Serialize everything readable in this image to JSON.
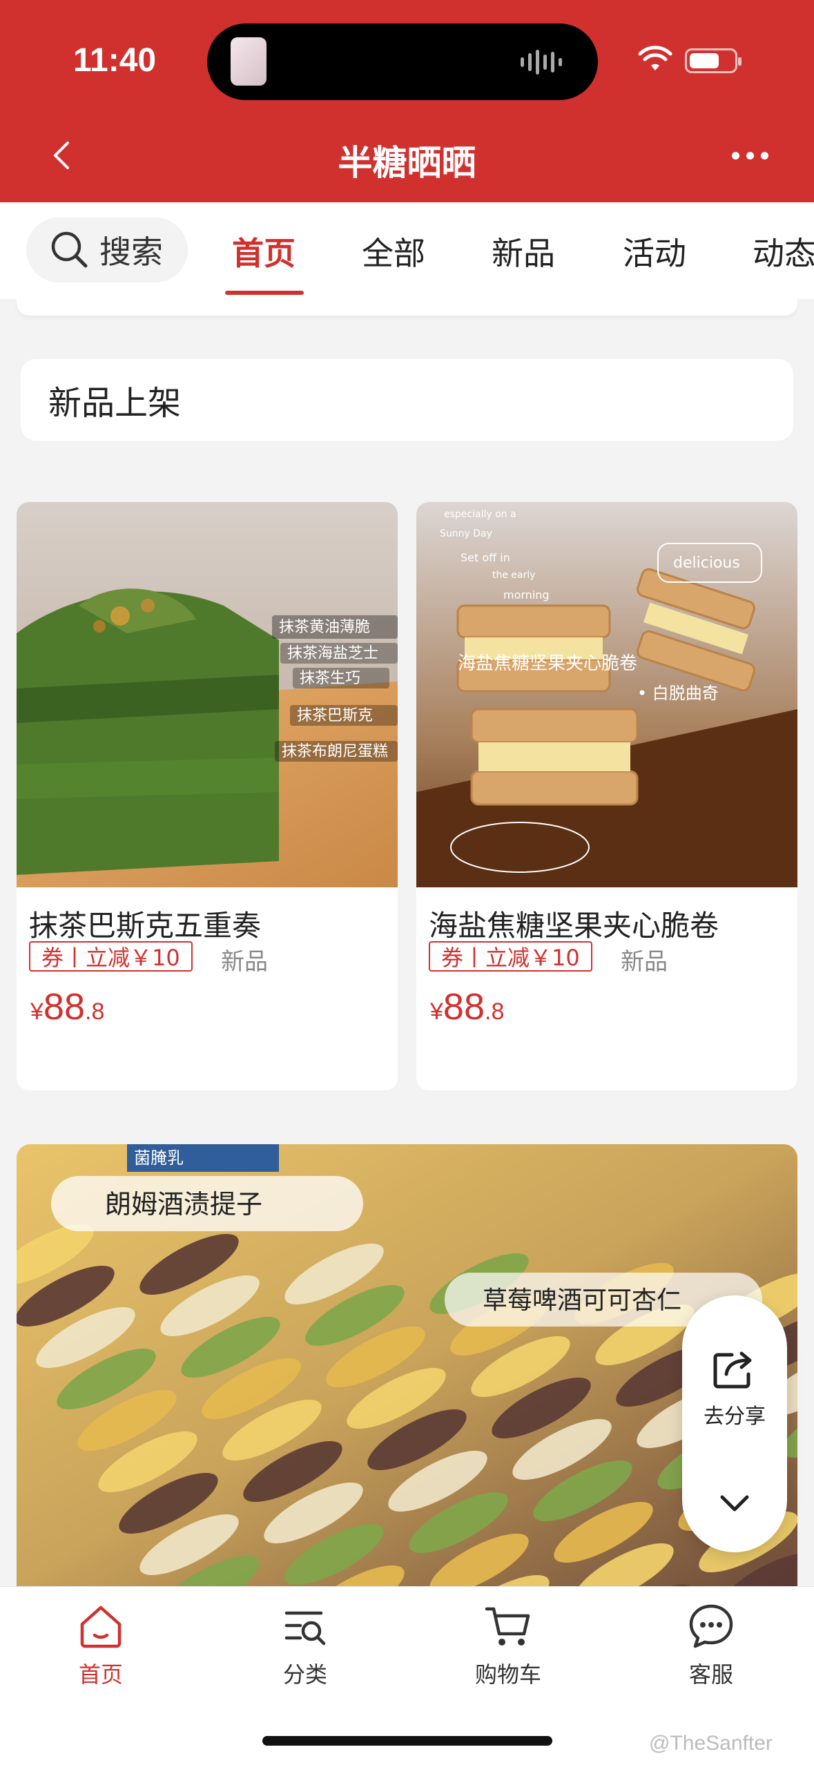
{
  "status": {
    "time": "11:40",
    "battery_level": 0.65
  },
  "header": {
    "title": "半糖晒晒"
  },
  "tabs": {
    "search_label": "搜索",
    "items": [
      "首页",
      "全部",
      "新品",
      "活动",
      "动态"
    ],
    "active": "首页"
  },
  "section": {
    "title": "新品上架"
  },
  "products": [
    {
      "name": "抹茶巴斯克五重奏",
      "coupon": "券丨立减￥10",
      "tag": "新品",
      "price_currency": "¥",
      "price_int": "88",
      "price_dec": ".8",
      "image_labels": [
        "抹茶黄油薄脆",
        "抹茶海盐芝士",
        "抹茶生巧",
        "抹茶巴斯克",
        "抹茶布朗尼蛋糕"
      ]
    },
    {
      "name": "海盐焦糖坚果夹心脆卷",
      "coupon": "券丨立减￥10",
      "tag": "新品",
      "price_currency": "¥",
      "price_int": "88",
      "price_dec": ".8",
      "image_labels": [
        "海盐焦糖坚果夹心脆卷",
        "• 白脱曲奇",
        "delicious",
        "especially on a",
        "Sunny Day",
        "Set off in",
        "the early",
        "morning"
      ]
    }
  ],
  "banner": {
    "labels": [
      "朗姆酒渍提子",
      "草莓啤酒可可杏仁",
      "菌腌乳"
    ]
  },
  "share": {
    "label": "去分享"
  },
  "bottom_nav": [
    {
      "label": "首页",
      "icon": "home-icon"
    },
    {
      "label": "分类",
      "icon": "category-search-icon"
    },
    {
      "label": "购物车",
      "icon": "cart-icon"
    },
    {
      "label": "客服",
      "icon": "chat-icon"
    }
  ],
  "watermark": "@TheSanfter",
  "colors": {
    "brand_red": "#d0312e",
    "background": "#f3f3f3"
  }
}
